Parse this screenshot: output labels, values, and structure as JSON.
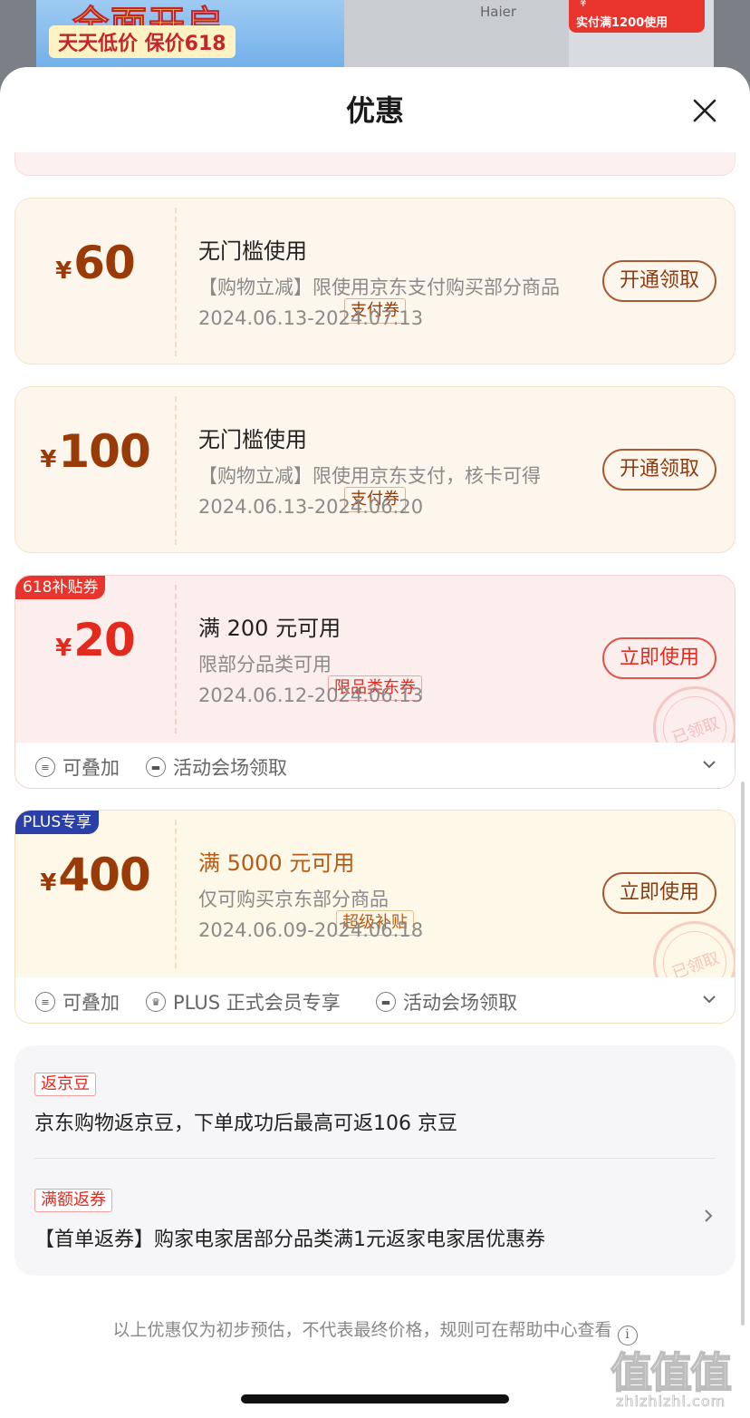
{
  "background": {
    "promo_line1": "全面开启",
    "promo_line2": "天天低价 保价618",
    "brand": "Haier",
    "price_yen": "¥",
    "price_condition": "实付满1200使用"
  },
  "sheet": {
    "title": "优惠",
    "close_icon": "close-icon"
  },
  "coupons": [
    {
      "yen": "¥",
      "amount": "60",
      "tag": "支付券",
      "title": "无门槛使用",
      "desc": "【购物立减】限使用京东支付购买部分商品",
      "date": "2024.06.13-2024.07.13",
      "button": "开通领取"
    },
    {
      "yen": "¥",
      "amount": "100",
      "tag": "支付券",
      "title": "无门槛使用",
      "desc": "【购物立减】限使用京东支付，核卡可得",
      "date": "2024.06.13-2024.06.20",
      "button": "开通领取"
    },
    {
      "badge": "618补贴券",
      "yen": "¥",
      "amount": "20",
      "tag": "限品类东券",
      "title": "满 200 元可用",
      "desc": "限部分品类可用",
      "date": "2024.06.12-2024.06.13",
      "button": "立即使用",
      "stamp": "已领取",
      "footer": [
        "可叠加",
        "活动会场领取"
      ]
    },
    {
      "badge": "PLUS专享",
      "yen": "¥",
      "amount": "400",
      "tag": "超级补贴",
      "title": "满 5000 元可用",
      "desc": "仅可购买京东部分商品",
      "date": "2024.06.09-2024.06.18",
      "button": "立即使用",
      "stamp": "已领取",
      "footer": [
        "可叠加",
        "PLUS 正式会员专享",
        "活动会场领取"
      ]
    }
  ],
  "info": {
    "jingdou_tag": "返京豆",
    "jingdou_text": "京东购物返京豆，下单成功后最高可返106 京豆",
    "return_tag": "满额返券",
    "return_text": "【首单返券】购家电家居部分品类满1元返家电家居优惠券"
  },
  "disclaimer": "以上优惠仅为初步预估，不代表最终价格，规则可在帮助中心查看",
  "watermark": {
    "big": "值值值",
    "small": "zhizhizhi.com"
  },
  "colors": {
    "pay_amount": "#9a3a06",
    "red_accent": "#e22a1e",
    "plus_badge": "#2b3fa8"
  }
}
